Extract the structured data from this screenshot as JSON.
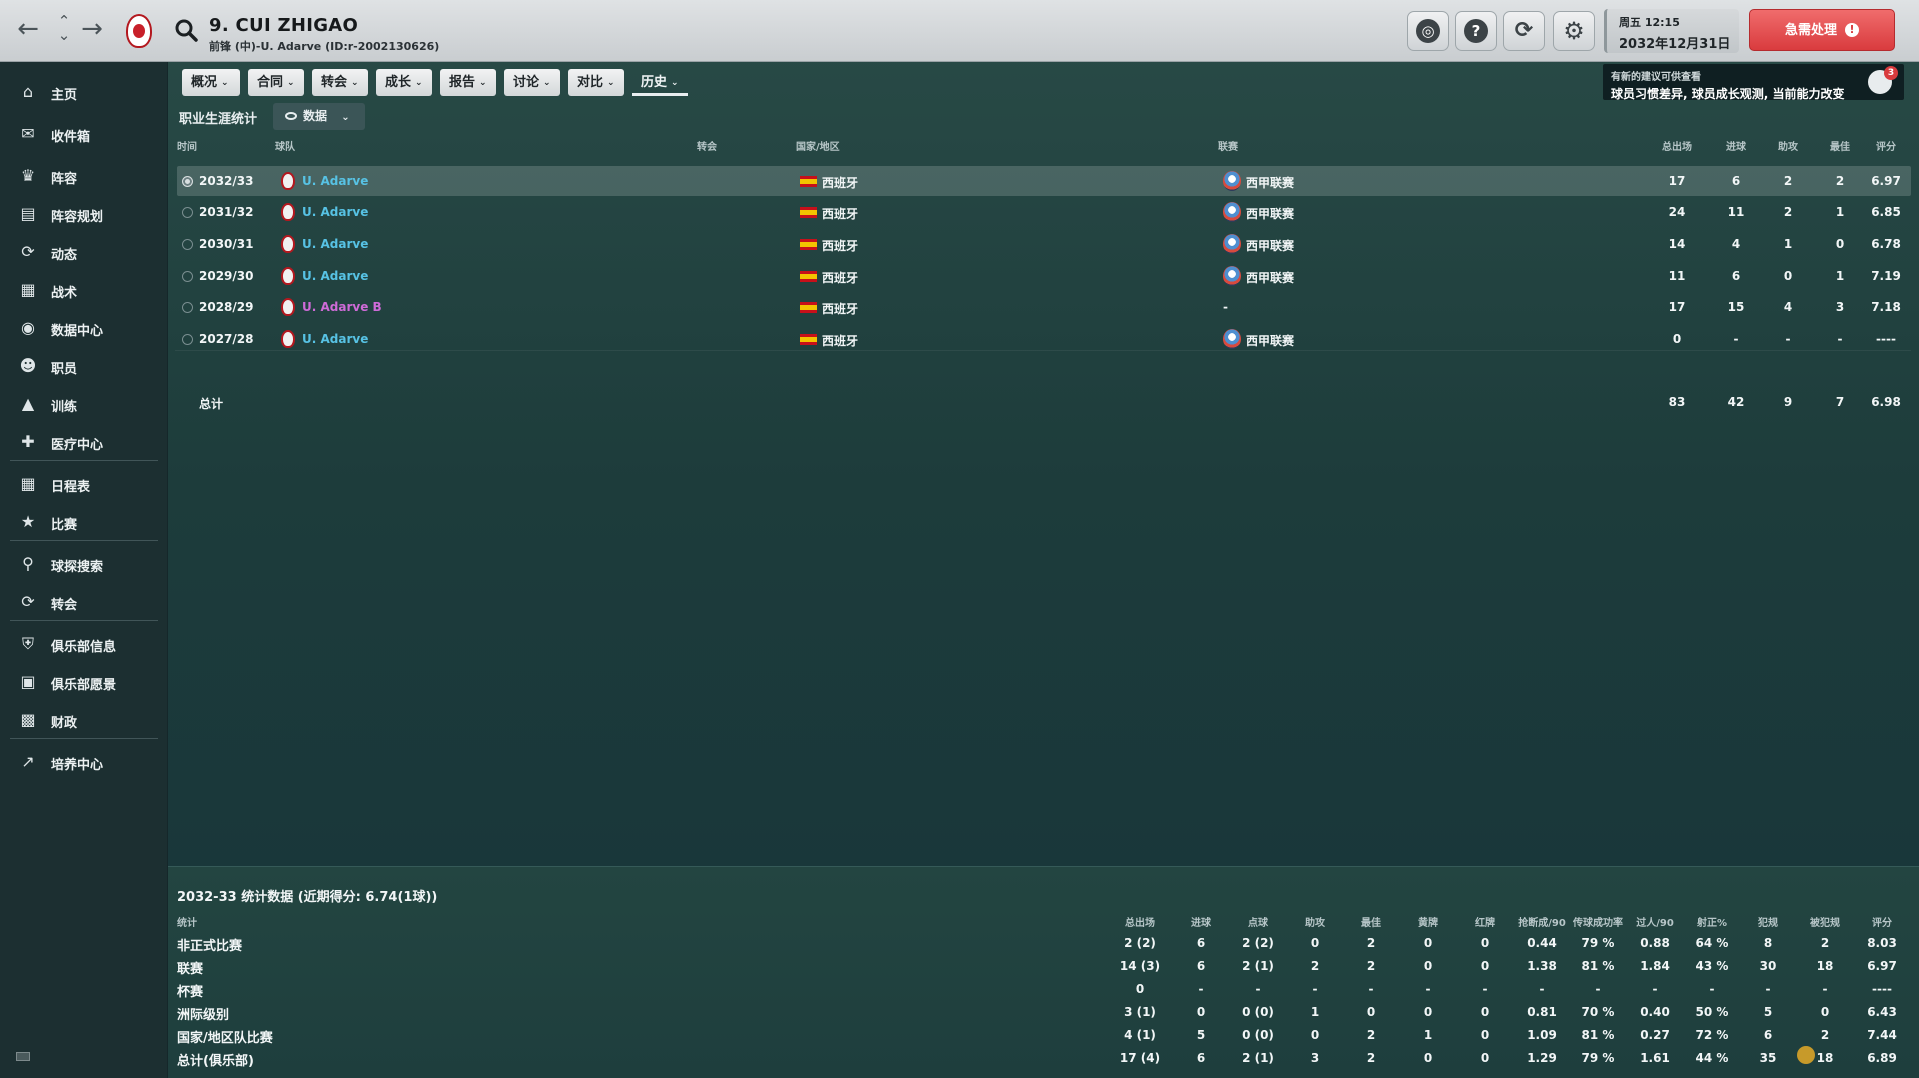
{
  "header": {
    "back_icon": "back-arrow-icon",
    "player_title": "9. CUI ZHIGAO",
    "player_subtitle": "前锋 (中)-U. Adarve (ID:r-2002130626)",
    "date_line1": "周五 12:15",
    "date_line2": "2032年12月31日",
    "urgent_label": "急需处理",
    "urgent_icon": "!"
  },
  "sidebar": {
    "items": [
      {
        "label": "主页",
        "icon": "home-icon"
      },
      {
        "label": "收件箱",
        "icon": "inbox-icon"
      },
      {
        "label": "阵容",
        "icon": "shirt-icon"
      },
      {
        "label": "阵容规划",
        "icon": "clipboard-icon"
      },
      {
        "label": "动态",
        "icon": "dynamics-icon"
      },
      {
        "label": "战术",
        "icon": "tactics-icon"
      },
      {
        "label": "数据中心",
        "icon": "data-hub-icon"
      },
      {
        "label": "职员",
        "icon": "staff-icon"
      },
      {
        "label": "训练",
        "icon": "training-icon"
      },
      {
        "label": "医疗中心",
        "icon": "medical-icon"
      },
      {
        "label": "日程表",
        "icon": "calendar-icon"
      },
      {
        "label": "比赛",
        "icon": "trophy-icon"
      },
      {
        "label": "球探搜索",
        "icon": "scout-search-icon"
      },
      {
        "label": "转会",
        "icon": "transfer-icon"
      },
      {
        "label": "俱乐部信息",
        "icon": "shield-icon"
      },
      {
        "label": "俱乐部愿景",
        "icon": "briefcase-icon"
      },
      {
        "label": "财政",
        "icon": "finance-icon"
      },
      {
        "label": "培养中心",
        "icon": "development-icon"
      }
    ]
  },
  "tabs": [
    {
      "label": "概况"
    },
    {
      "label": "合同"
    },
    {
      "label": "转会"
    },
    {
      "label": "成长"
    },
    {
      "label": "报告"
    },
    {
      "label": "讨论"
    },
    {
      "label": "对比"
    },
    {
      "label": "历史"
    }
  ],
  "advice": {
    "line1": "有新的建议可供查看",
    "line2": "球员习惯差异, 球员成长观测, 当前能力改变",
    "badge": "3"
  },
  "career": {
    "section_label": "职业生涯统计",
    "view_label": "数据",
    "columns": {
      "time": "时间",
      "team": "球队",
      "transfer": "转会",
      "country": "国家/地区",
      "league": "联赛",
      "apps": "总出场",
      "goals": "进球",
      "assists": "助攻",
      "pom": "最佳",
      "rating": "评分"
    },
    "rows": [
      {
        "season": "2032/33",
        "team": "U. Adarve",
        "country": "西班牙",
        "league": "西甲联赛",
        "apps": "17",
        "goals": "6",
        "assists": "2",
        "pom": "2",
        "rating": "6.97"
      },
      {
        "season": "2031/32",
        "team": "U. Adarve",
        "country": "西班牙",
        "league": "西甲联赛",
        "apps": "24",
        "goals": "11",
        "assists": "2",
        "pom": "1",
        "rating": "6.85"
      },
      {
        "season": "2030/31",
        "team": "U. Adarve",
        "country": "西班牙",
        "league": "西甲联赛",
        "apps": "14",
        "goals": "4",
        "assists": "1",
        "pom": "0",
        "rating": "6.78"
      },
      {
        "season": "2029/30",
        "team": "U. Adarve",
        "country": "西班牙",
        "league": "西甲联赛",
        "apps": "11",
        "goals": "6",
        "assists": "0",
        "pom": "1",
        "rating": "7.19"
      },
      {
        "season": "2028/29",
        "team": "U. Adarve B",
        "country": "西班牙",
        "league": "-",
        "apps": "17",
        "goals": "15",
        "assists": "4",
        "pom": "3",
        "rating": "7.18"
      },
      {
        "season": "2027/28",
        "team": "U. Adarve",
        "country": "西班牙",
        "league": "西甲联赛",
        "apps": "0",
        "goals": "-",
        "assists": "-",
        "pom": "-",
        "rating": "----"
      }
    ],
    "total": {
      "label": "总计",
      "apps": "83",
      "goals": "42",
      "assists": "9",
      "pom": "7",
      "rating": "6.98"
    }
  },
  "season_stats": {
    "title": "2032-33 统计数据 (近期得分: 6.74(1球))",
    "headers": [
      "统计",
      "总出场",
      "进球",
      "点球",
      "助攻",
      "最佳",
      "黄牌",
      "红牌",
      "抢断成/90",
      "传球成功率",
      "过人/90",
      "射正%",
      "犯规",
      "被犯规",
      "评分"
    ],
    "rows": [
      {
        "label": "非正式比赛",
        "cells": [
          "2 (2)",
          "6",
          "2 (2)",
          "0",
          "2",
          "0",
          "0",
          "0.44",
          "79 %",
          "0.88",
          "64 %",
          "8",
          "2",
          "8.03"
        ]
      },
      {
        "label": "联赛",
        "cells": [
          "14 (3)",
          "6",
          "2 (1)",
          "2",
          "2",
          "0",
          "0",
          "1.38",
          "81 %",
          "1.84",
          "43 %",
          "30",
          "18",
          "6.97"
        ]
      },
      {
        "label": "杯赛",
        "cells": [
          "0",
          "-",
          "-",
          "-",
          "-",
          "-",
          "-",
          "-",
          "-",
          "-",
          "-",
          "-",
          "-",
          "----"
        ]
      },
      {
        "label": "洲际级别",
        "cells": [
          "3 (1)",
          "0",
          "0 (0)",
          "1",
          "0",
          "0",
          "0",
          "0.81",
          "70 %",
          "0.40",
          "50 %",
          "5",
          "0",
          "6.43"
        ]
      },
      {
        "label": "国家/地区队比赛",
        "cells": [
          "4 (1)",
          "5",
          "0 (0)",
          "0",
          "2",
          "1",
          "0",
          "1.09",
          "81 %",
          "0.27",
          "72 %",
          "6",
          "2",
          "7.44"
        ]
      },
      {
        "label": "总计(俱乐部)",
        "cells": [
          "17 (4)",
          "6",
          "2 (1)",
          "3",
          "2",
          "0",
          "0",
          "1.29",
          "79 %",
          "1.61",
          "44 %",
          "35",
          "18",
          "6.89"
        ]
      }
    ]
  }
}
